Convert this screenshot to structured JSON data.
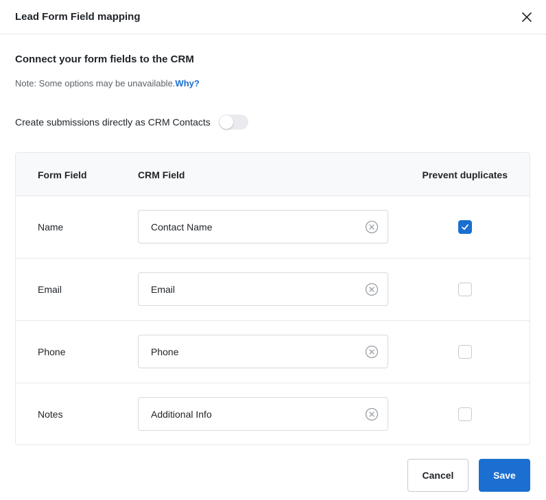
{
  "header": {
    "title": "Lead Form Field mapping"
  },
  "section": {
    "title": "Connect your form fields to the CRM",
    "note_text": "Note: Some options may be unavailable.",
    "note_link": "Why?"
  },
  "toggle": {
    "label": "Create submissions directly as CRM Contacts",
    "enabled": false
  },
  "table": {
    "headers": {
      "form_field": "Form Field",
      "crm_field": "CRM Field",
      "prevent_duplicates": "Prevent duplicates"
    },
    "rows": [
      {
        "form_field": "Name",
        "crm_field": "Contact Name",
        "prevent_duplicates": true
      },
      {
        "form_field": "Email",
        "crm_field": "Email",
        "prevent_duplicates": false
      },
      {
        "form_field": "Phone",
        "crm_field": "Phone",
        "prevent_duplicates": false
      },
      {
        "form_field": "Notes",
        "crm_field": "Additional Info",
        "prevent_duplicates": false
      }
    ]
  },
  "footer": {
    "cancel_label": "Cancel",
    "save_label": "Save"
  },
  "colors": {
    "accent": "#1a6fd0",
    "border": "#e6e8eb",
    "header_bg": "#f8f9fa"
  },
  "icons": {
    "close": "close-icon",
    "clear": "clear-circle-icon",
    "check": "check-icon"
  }
}
